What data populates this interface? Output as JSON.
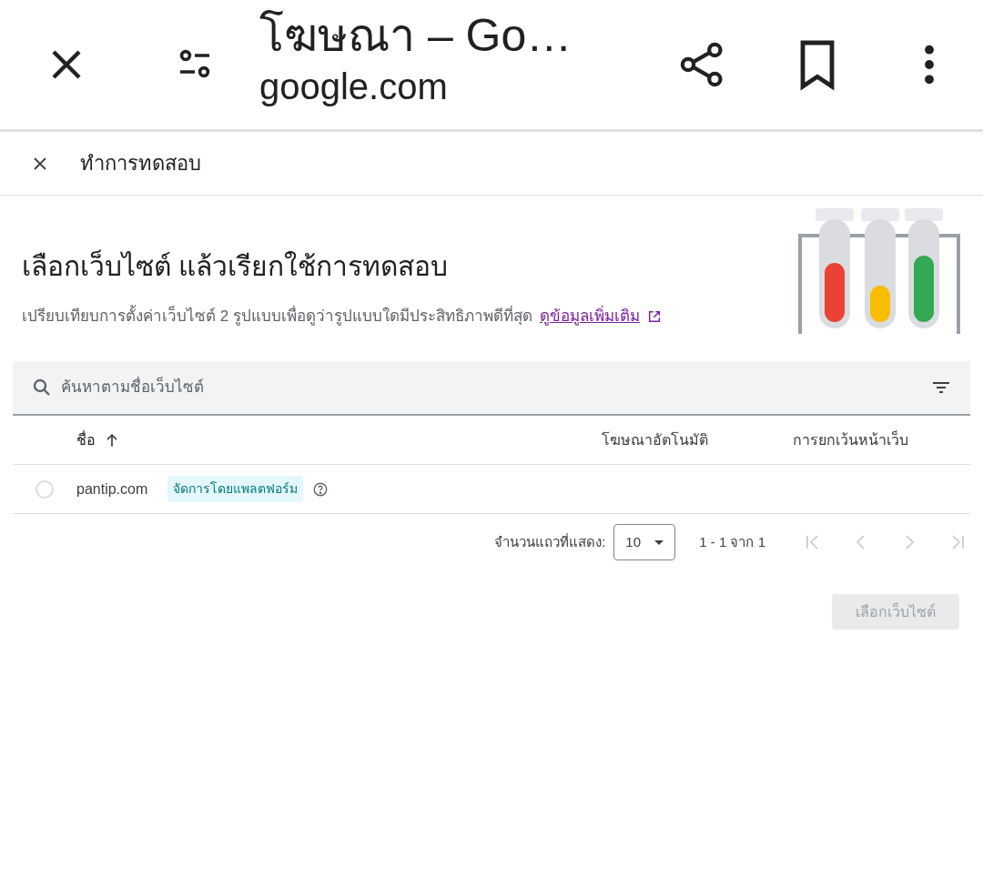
{
  "browser_bar": {
    "title": "โฆษณา – Go…",
    "url": "google.com"
  },
  "dialog_header": {
    "title": "ทำการทดสอบ"
  },
  "intro": {
    "heading": "เลือกเว็บไซต์ แล้วเรียกใช้การทดสอบ",
    "description": "เปรียบเทียบการตั้งค่าเว็บไซต์ 2 รูปแบบเพื่อดูว่ารูปแบบใดมีประสิทธิภาพดีที่สุด",
    "link": "ดูข้อมูลเพิ่มเติม"
  },
  "search": {
    "placeholder": "ค้นหาตามชื่อเว็บไซต์"
  },
  "table": {
    "columns": [
      {
        "label": "ชื่อ",
        "sorted": true
      },
      {
        "label": "โฆษณาอัตโนมัติ",
        "sorted": false
      },
      {
        "label": "การยกเว้นหน้าเว็บ",
        "sorted": false
      }
    ],
    "rows": [
      {
        "name": "pantip.com",
        "tag": "จัดการโดยแพลตฟอร์ม",
        "selected": false
      }
    ]
  },
  "pagination": {
    "rows_label": "จำนวนแถวที่แสดง:",
    "rows_value": "10",
    "range": "1 - 1 จาก 1",
    "first_disabled": true,
    "prev_disabled": true,
    "next_disabled": true,
    "last_disabled": true
  },
  "select_button": {
    "label": "เลือกเว็บไซต์",
    "disabled": true
  }
}
